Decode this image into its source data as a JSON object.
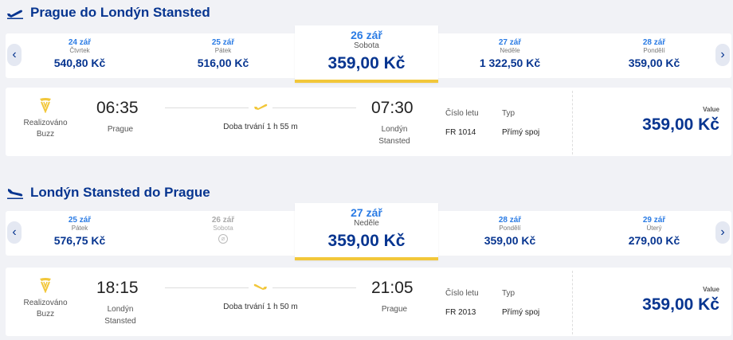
{
  "outbound": {
    "title": "Prague do Londýn Stansted",
    "days": [
      {
        "date": "24 zář",
        "weekday": "Čtvrtek",
        "price": "540,80 Kč"
      },
      {
        "date": "25 zář",
        "weekday": "Pátek",
        "price": "516,00 Kč"
      },
      {
        "date": "26 zář",
        "weekday": "Sobota",
        "price": "359,00 Kč",
        "selected": true
      },
      {
        "date": "27 zář",
        "weekday": "Neděle",
        "price": "1 322,50 Kč"
      },
      {
        "date": "28 zář",
        "weekday": "Pondělí",
        "price": "359,00 Kč"
      }
    ],
    "flight": {
      "airline_line1": "Realizováno",
      "airline_line2": "Buzz",
      "depart_time": "06:35",
      "depart_place": "Prague",
      "duration": "Doba trvání 1 h 55 m",
      "arrive_time": "07:30",
      "arrive_place_line1": "Londýn",
      "arrive_place_line2": "Stansted",
      "flight_no_label": "Číslo letu",
      "flight_no": "FR 1014",
      "type_label": "Typ",
      "type": "Přímý spoj",
      "value_label": "Value",
      "value": "359,00 Kč"
    }
  },
  "inbound": {
    "title": "Londýn Stansted do Prague",
    "days": [
      {
        "date": "25 zář",
        "weekday": "Pátek",
        "price": "576,75 Kč"
      },
      {
        "date": "26 zář",
        "weekday": "Sobota",
        "price": "",
        "disabled": true
      },
      {
        "date": "27 zář",
        "weekday": "Neděle",
        "price": "359,00 Kč",
        "selected": true
      },
      {
        "date": "28 zář",
        "weekday": "Pondělí",
        "price": "359,00 Kč"
      },
      {
        "date": "29 zář",
        "weekday": "Úterý",
        "price": "279,00 Kč"
      }
    ],
    "flight": {
      "airline_line1": "Realizováno",
      "airline_line2": "Buzz",
      "depart_time": "18:15",
      "depart_place_line1": "Londýn",
      "depart_place_line2": "Stansted",
      "duration": "Doba trvání 1 h 50 m",
      "arrive_time": "21:05",
      "arrive_place": "Prague",
      "flight_no_label": "Číslo letu",
      "flight_no": "FR 2013",
      "type_label": "Typ",
      "type": "Přímý spoj",
      "value_label": "Value",
      "value": "359,00 Kč"
    }
  },
  "icons": {
    "departure": "plane-takeoff-icon",
    "arrival": "plane-landing-icon",
    "nav_prev": "chevron-left-icon",
    "nav_next": "chevron-right-icon",
    "airline_logo": "harp-logo-icon",
    "route_plane": "plane-icon"
  },
  "colors": {
    "brand": "#073590",
    "date_blue": "#2a7be4",
    "accent_yellow": "#f2c73a",
    "background": "#f1f2f6"
  }
}
